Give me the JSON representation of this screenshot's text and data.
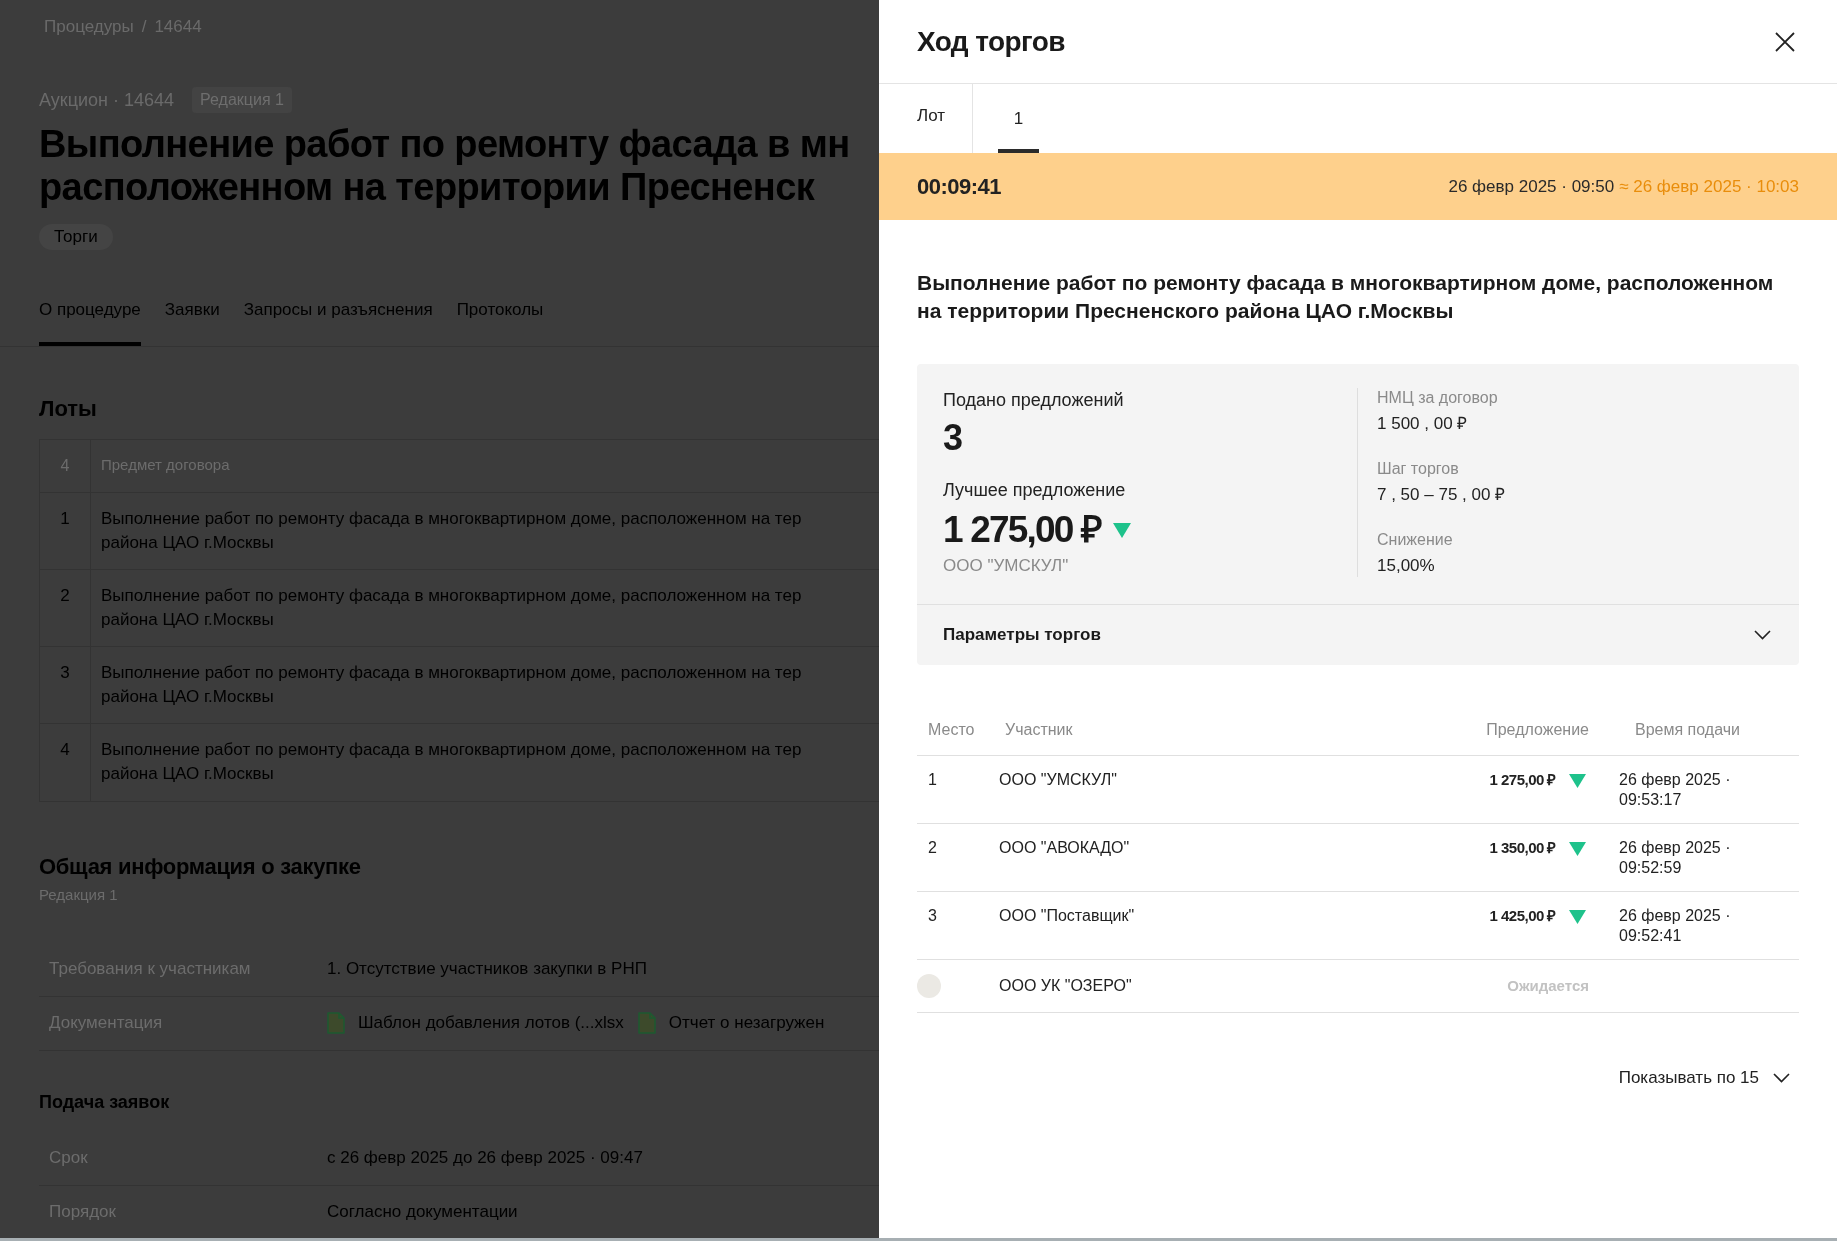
{
  "background_page": {
    "breadcrumb": {
      "items": [
        "Процедуры",
        "14644"
      ],
      "separator": "/"
    },
    "procedure_type": "Аукцион · 14644",
    "revision_badge": "Редакция 1",
    "title_lines": [
      "Выполнение работ по ремонту фасада в мн",
      "расположенном на территории Пресненск"
    ],
    "tag": "Торги",
    "tabs": [
      {
        "label": "О процедуре",
        "selected": true
      },
      {
        "label": "Заявки",
        "selected": false
      },
      {
        "label": "Запросы и разъяснения",
        "selected": false
      },
      {
        "label": "Протоколы",
        "selected": false
      }
    ],
    "lots": {
      "heading": "Лоты",
      "columns": [
        "4",
        "Предмет договора"
      ],
      "rows": [
        {
          "number": "1",
          "subject_lines": [
            "Выполнение работ по ремонту фасада в многоквартирном доме, расположенном на тер",
            "района ЦАО г.Москвы"
          ]
        },
        {
          "number": "2",
          "subject_lines": [
            "Выполнение работ по ремонту фасада в многоквартирном доме, расположенном на тер",
            "района ЦАО г.Москвы"
          ]
        },
        {
          "number": "3",
          "subject_lines": [
            "Выполнение работ по ремонту фасада в многоквартирном доме, расположенном на тер",
            "района ЦАО г.Москвы"
          ]
        },
        {
          "number": "4",
          "subject_lines": [
            "Выполнение работ по ремонту фасада в многоквартирном доме, расположенном на тер",
            "района ЦАО г.Москвы"
          ]
        }
      ]
    },
    "general_info": {
      "heading": "Общая информация о закупке",
      "subheading": "Редакция 1",
      "rows": [
        {
          "kind": "text",
          "label": "Требования к участникам",
          "value": "1. Отсутствие участников закупки в РНП"
        },
        {
          "kind": "files",
          "label": "Документация",
          "files": [
            "Шаблон добавления лотов (...xlsx",
            "Отчет о незагружен"
          ]
        }
      ]
    },
    "applications": {
      "heading": "Подача заявок",
      "rows": [
        {
          "kind": "text",
          "label": "Срок",
          "value": "с 26 февр 2025 до 26 февр 2025 · 09:47"
        },
        {
          "kind": "text",
          "label": "Порядок",
          "value": "Согласно документации"
        }
      ]
    }
  },
  "drawer": {
    "title": "Ход торгов",
    "lot_tabs": {
      "label": "Лот",
      "tabs": [
        {
          "label": "1",
          "selected": true
        }
      ]
    },
    "timer": {
      "remaining": "00:09:41",
      "start": "26 февр 2025 · 09:50",
      "end": "≈ 26 февр 2025 · 10:03"
    },
    "lot_title": "Выполнение работ по ремонту фасада в многоквартирном доме, расположенном на территории Пресненского района ЦАО г.Москвы",
    "summary": {
      "bids_label": "Подано предложений",
      "bids_count": "3",
      "best_label": "Лучшее предложение",
      "best_amount": "1 275,00 ₽",
      "best_decreased": true,
      "best_bidder": "ООО \"УМСКУЛ\"",
      "facts": [
        {
          "label": "НМЦ за договор",
          "value": "1 500 , 00 ₽"
        },
        {
          "label": "Шаг торгов",
          "value": "7 , 50 – 75 , 00 ₽"
        },
        {
          "label": "Снижение",
          "value": "15,00%"
        }
      ]
    },
    "parameters": {
      "label": "Параметры торгов",
      "expanded": false
    },
    "bids_table": {
      "columns": [
        "Место",
        "Участник",
        "Предложение",
        "Время подачи"
      ],
      "rows": [
        {
          "kind": "bid",
          "place": "1",
          "participant": "ООО \"УМСКУЛ\"",
          "amount": "1 275,00 ₽",
          "decreased": true,
          "time": "26 февр 2025 · 09:53:17"
        },
        {
          "kind": "bid",
          "place": "2",
          "participant": "ООО \"АВОКАДО\"",
          "amount": "1 350,00 ₽",
          "decreased": true,
          "time": "26 февр 2025 · 09:52:59"
        },
        {
          "kind": "bid",
          "place": "3",
          "participant": "ООО \"Поставщик\"",
          "amount": "1 425,00 ₽",
          "decreased": true,
          "time": "26 февр 2025 · 09:52:41"
        },
        {
          "kind": "pending",
          "participant": "ООО УК \"ОЗЕРО\"",
          "status": "Ожидается"
        }
      ]
    },
    "page_size": {
      "label": "Показывать по 15"
    }
  }
}
